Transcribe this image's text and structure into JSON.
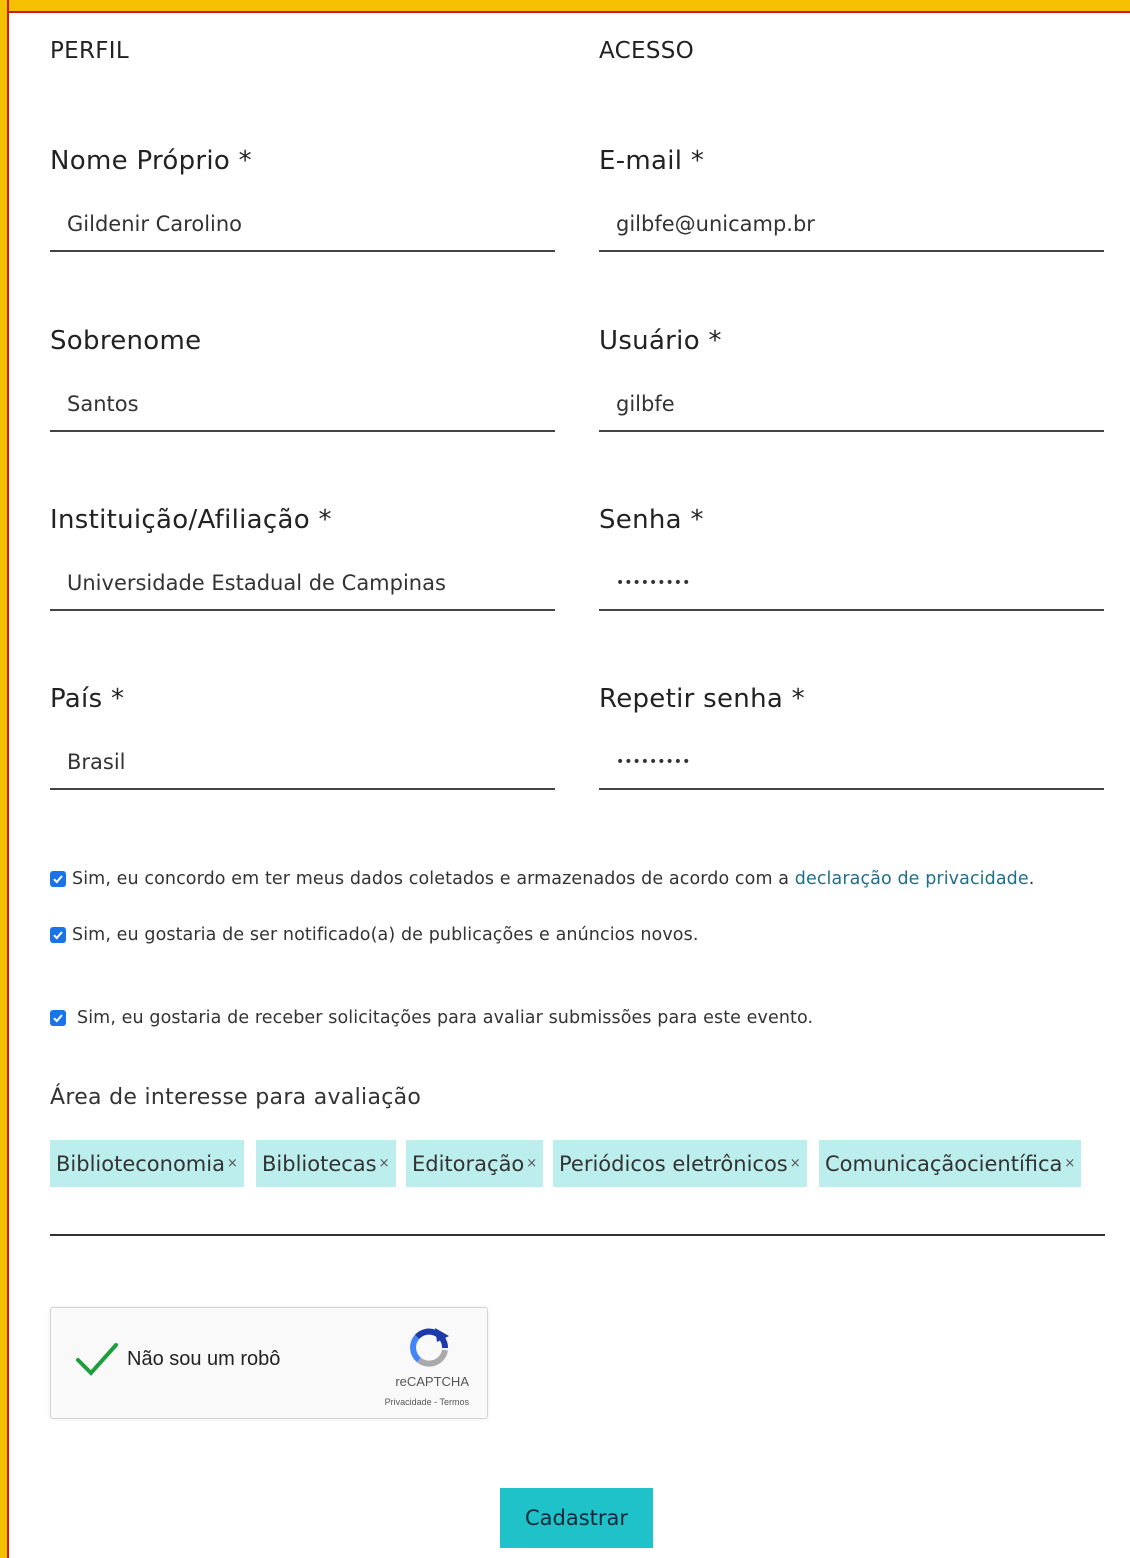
{
  "sections": {
    "profile": "PERFIL",
    "access": "ACESSO"
  },
  "fields": {
    "nome": {
      "label": "Nome Próprio *",
      "value": "Gildenir Carolino"
    },
    "sobrenome": {
      "label": "Sobrenome",
      "value": "Santos"
    },
    "instituicao": {
      "label": "Instituição/Afiliação *",
      "value": "Universidade Estadual de Campinas"
    },
    "pais": {
      "label": "País *",
      "value": "Brasil"
    },
    "email": {
      "label": "E-mail *",
      "value": "gilbfe@unicamp.br"
    },
    "usuario": {
      "label": "Usuário *",
      "value": "gilbfe"
    },
    "senha": {
      "label": "Senha *",
      "value": "•••••••••"
    },
    "repetir_senha": {
      "label": "Repetir senha *",
      "value": "•••••••••"
    }
  },
  "consents": {
    "privacy": {
      "text": "Sim, eu concordo em ter meus dados coletados e armazenados de acordo com a ",
      "link": "declaração de privacidade",
      "end": ".",
      "checked": true
    },
    "notify": {
      "text": "Sim, eu gostaria de ser notificado(a) de publicações e anúncios novos.",
      "checked": true
    },
    "review": {
      "text": "Sim, eu gostaria de receber solicitações para avaliar submissões para este evento.",
      "checked": true
    }
  },
  "review_area": {
    "label": "Área de interesse para avaliação",
    "tags": [
      "Biblioteconomia",
      "Bibliotecas",
      "Editoração",
      "Periódicos eletrônicos",
      "Comunicaçãocientífica"
    ],
    "remove_symbol": "×"
  },
  "captcha": {
    "label": "Não sou um robô",
    "brand": "reCAPTCHA",
    "links": "Privacidade - Termos"
  },
  "submit_label": "Cadastrar",
  "colors": {
    "frame": "#f5c000",
    "frame_border": "#d21a1a",
    "tag_bg": "#bdeeee",
    "button_bg": "#1fc2c8",
    "link": "#1f6e8c",
    "checkbox": "#1a73e8"
  }
}
